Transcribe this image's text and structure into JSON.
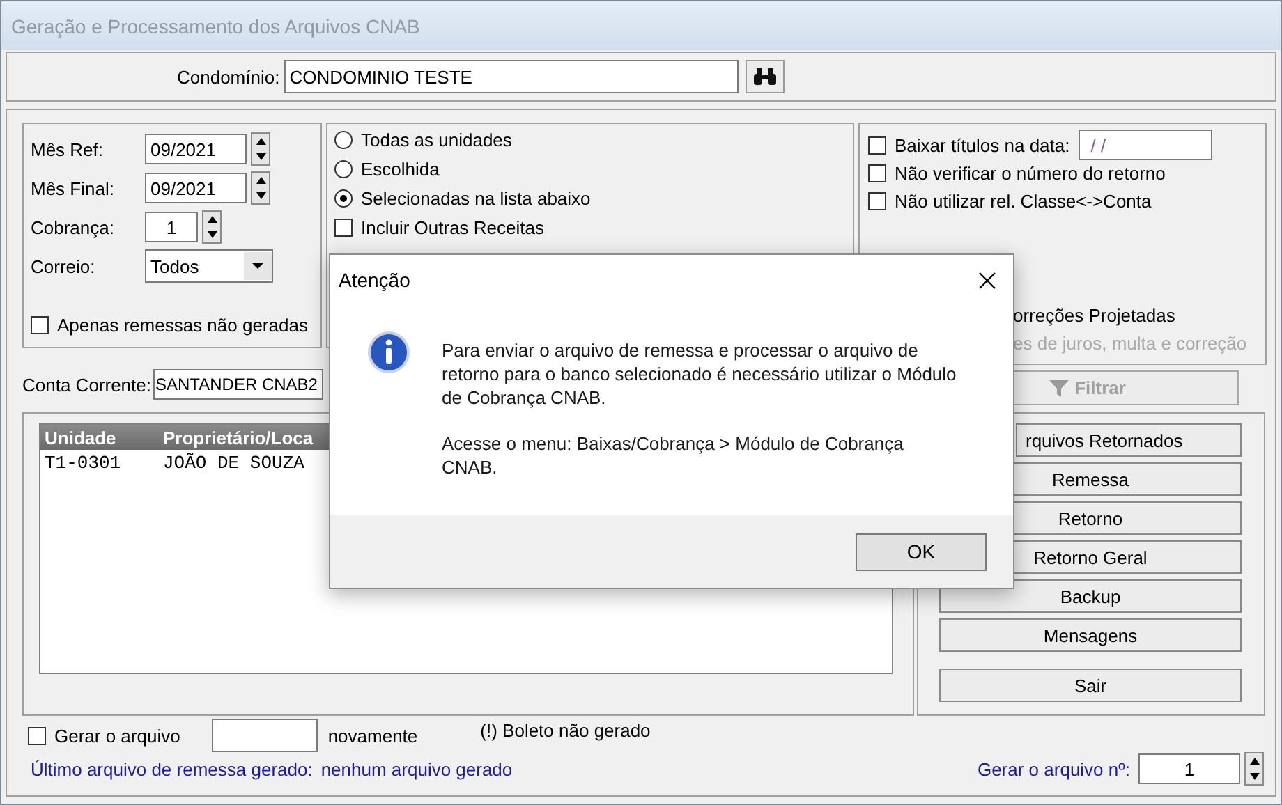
{
  "window": {
    "title": "Geração e Processamento dos Arquivos CNAB"
  },
  "condominio": {
    "label": "Condomínio:",
    "value": "CONDOMINIO TESTE"
  },
  "period": {
    "fields": [
      {
        "label": "Mês Ref:",
        "value": "09/2021",
        "kind": "spinner"
      },
      {
        "label": "Mês Final:",
        "value": "09/2021",
        "kind": "spinner"
      },
      {
        "label": "Cobrança:",
        "value": "1",
        "kind": "spinner"
      },
      {
        "label": "Correio:",
        "value": "Todos",
        "kind": "dropdown"
      }
    ],
    "only_pending": {
      "label": "Apenas remessas não geradas",
      "checked": false
    }
  },
  "units": {
    "options": [
      {
        "label": "Todas as unidades",
        "selected": false
      },
      {
        "label": "Escolhida",
        "selected": false
      },
      {
        "label": "Selecionadas na lista abaixo",
        "selected": true
      }
    ],
    "include_other": {
      "label": "Incluir Outras Receitas",
      "checked": false
    }
  },
  "return_options": {
    "checks": [
      {
        "label": "Baixar títulos na data:",
        "checked": false,
        "date_value": "/ /"
      },
      {
        "label": "Não verificar o número do retorno",
        "checked": false
      },
      {
        "label": "Não utilizar rel. Classe<->Conta",
        "checked": false
      }
    ],
    "projected": {
      "label": "orreções Projetadas",
      "hint": "es de juros, multa e correção"
    }
  },
  "account": {
    "label": "Conta Corrente:",
    "value": "SANTANDER CNAB2"
  },
  "filter_button": {
    "label": "Filtrar",
    "disabled": true
  },
  "table": {
    "columns": [
      "Unidade",
      "Proprietário/Loca"
    ],
    "rows": [
      [
        "T1-0301",
        "JOÃO DE SOUZA"
      ]
    ]
  },
  "actions": [
    "rquivos Retornados",
    "Remessa",
    "Retorno",
    "Retorno Geral",
    "Backup",
    "Mensagens"
  ],
  "exit_button": "Sair",
  "regenerate": {
    "label": "Gerar o arquivo",
    "checked": false,
    "suffix": "novamente"
  },
  "legend": "(!) Boleto não gerado",
  "last_file": {
    "label": "Último arquivo de remessa gerado:",
    "value": "nenhum arquivo gerado"
  },
  "file_number": {
    "label": "Gerar o arquivo nº:",
    "value": "1"
  },
  "dialog": {
    "title": "Atenção",
    "paragraphs": [
      "Para enviar o arquivo de remessa e processar o arquivo de retorno para o banco selecionado é necessário utilizar o Módulo de Cobrança CNAB.",
      "Acesse o menu: Baixas/Cobrança > Módulo de Cobrança CNAB."
    ],
    "button": "OK"
  }
}
